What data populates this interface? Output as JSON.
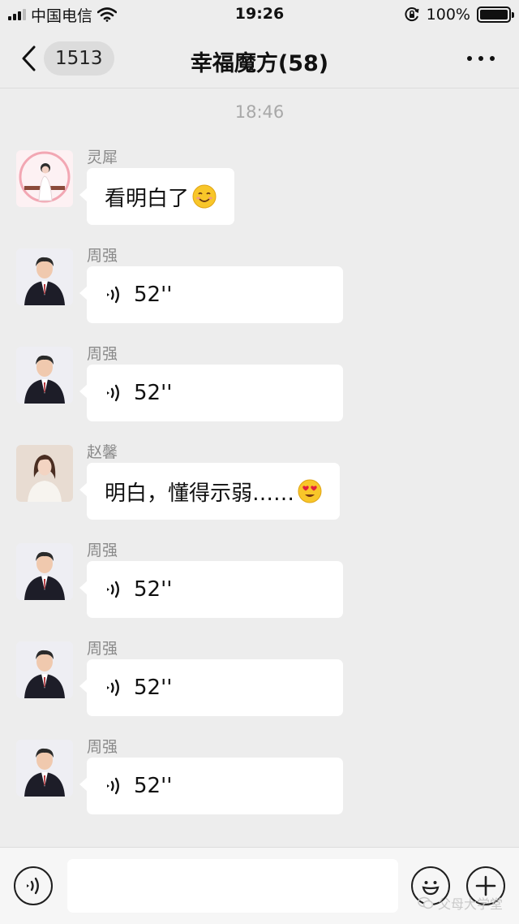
{
  "status_bar": {
    "carrier": "中国电信",
    "time": "19:26",
    "battery": "100%",
    "icons": [
      "signal-icon",
      "wifi-icon",
      "orientation-lock-icon",
      "battery-icon"
    ]
  },
  "nav": {
    "unread_count": "1513",
    "title": "幸福魔方(58)"
  },
  "chat": {
    "timestamp": "18:46",
    "messages": [
      {
        "sender": "灵犀",
        "type": "text",
        "text": "看明白了",
        "emoji": "smiling-face-emoji"
      },
      {
        "sender": "周强",
        "type": "voice",
        "duration": "52''"
      },
      {
        "sender": "周强",
        "type": "voice",
        "duration": "52''"
      },
      {
        "sender": "赵馨",
        "type": "text",
        "text": "明白，懂得示弱……",
        "emoji": "heart-eyes-emoji"
      },
      {
        "sender": "周强",
        "type": "voice",
        "duration": "52''"
      },
      {
        "sender": "周强",
        "type": "voice",
        "duration": "52''"
      },
      {
        "sender": "周强",
        "type": "voice",
        "duration": "52''"
      }
    ]
  },
  "input_bar": {
    "icons": [
      "voice-mode-icon",
      "emoji-icon",
      "plus-icon"
    ],
    "watermark": "父母大学堂"
  },
  "colors": {
    "background": "#ededed",
    "bubble": "#ffffff",
    "meta_text": "#8a8a8a"
  }
}
